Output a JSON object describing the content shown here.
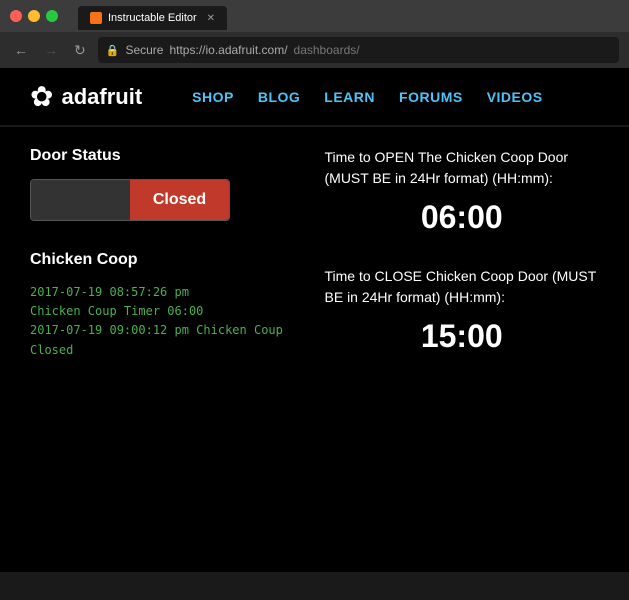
{
  "browser": {
    "title": "Instructable Editor",
    "url_protocol": "Secure",
    "url": "https://io.adafruit.com/",
    "url_suffix": "dashboards/",
    "tab_label": "Instructable Editor"
  },
  "header": {
    "logo_text": "adafruit",
    "nav": [
      {
        "label": "SHOP"
      },
      {
        "label": "BLOG"
      },
      {
        "label": "LEARN"
      },
      {
        "label": "FORUMS"
      },
      {
        "label": "VIDEOS"
      }
    ]
  },
  "left": {
    "door_status_title": "Door Status",
    "door_open_label": "",
    "door_closed_label": "Closed",
    "chicken_section_title": "Chicken Coop",
    "log_entries": [
      "2017-07-19 08:57:26 pm",
      "Chicken Coup Timer 06:00",
      "2017-07-19 09:00:12 pm Chicken Coup",
      "Closed"
    ]
  },
  "right": {
    "open_label": "Time to OPEN The Chicken Coop Door (MUST BE in 24Hr format) (HH:mm):",
    "open_time": "06:00",
    "close_label": "Time to CLOSE Chicken Coop Door (MUST BE in 24Hr format) (HH:mm):",
    "close_time": "15:00"
  },
  "colors": {
    "green_text": "#4caf50",
    "red_button": "#c0392b",
    "blue_link": "#4fc3f7",
    "white": "#ffffff",
    "black": "#000000"
  }
}
